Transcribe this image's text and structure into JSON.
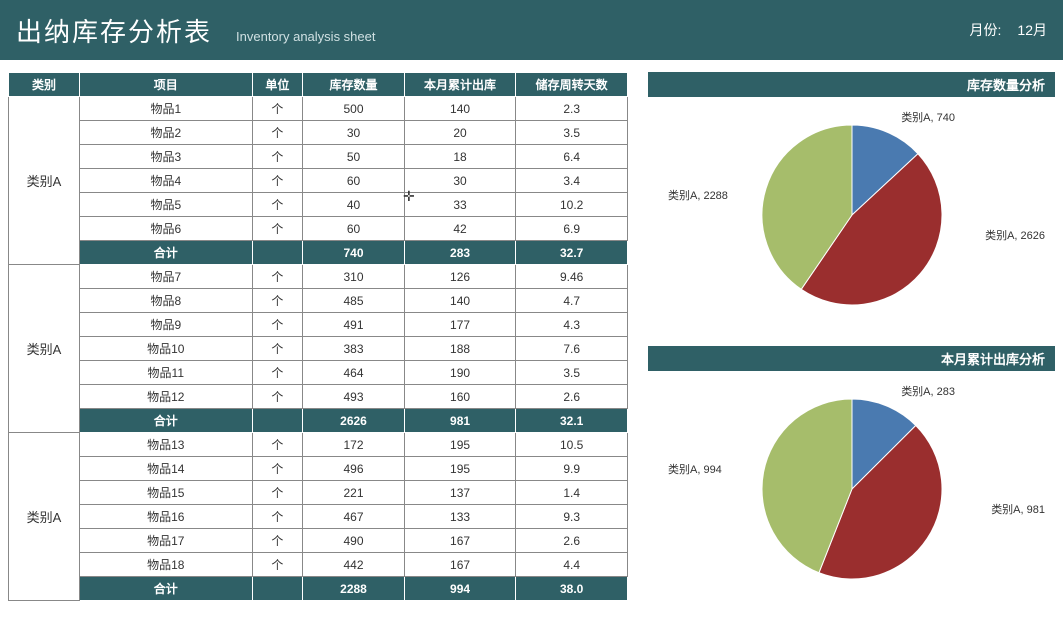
{
  "header": {
    "title": "出纳库存分析表",
    "subtitle": "Inventory analysis sheet",
    "month_label": "月份:",
    "month_value": "12月"
  },
  "columns": {
    "cat": "类别",
    "item": "项目",
    "unit": "单位",
    "qty": "库存数量",
    "out": "本月累计出库",
    "turn": "储存周转天数"
  },
  "subtotal_label": "合计",
  "unit_default": "个",
  "groups": [
    {
      "cat": "类别A",
      "rows": [
        {
          "item": "物品1",
          "unit": "个",
          "qty": 500,
          "out": 140,
          "turn": 2.3
        },
        {
          "item": "物品2",
          "unit": "个",
          "qty": 30,
          "out": 20,
          "turn": 3.5
        },
        {
          "item": "物品3",
          "unit": "个",
          "qty": 50,
          "out": 18,
          "turn": 6.4
        },
        {
          "item": "物品4",
          "unit": "个",
          "qty": 60,
          "out": 30,
          "turn": 3.4
        },
        {
          "item": "物品5",
          "unit": "个",
          "qty": 40,
          "out": 33,
          "turn": 10.2
        },
        {
          "item": "物品6",
          "unit": "个",
          "qty": 60,
          "out": 42,
          "turn": 6.9
        }
      ],
      "subtotal": {
        "qty": 740,
        "out": 283,
        "turn": 32.7
      }
    },
    {
      "cat": "类别A",
      "rows": [
        {
          "item": "物品7",
          "unit": "个",
          "qty": 310,
          "out": 126,
          "turn": 9.46
        },
        {
          "item": "物品8",
          "unit": "个",
          "qty": 485,
          "out": 140,
          "turn": 4.7
        },
        {
          "item": "物品9",
          "unit": "个",
          "qty": 491,
          "out": 177,
          "turn": 4.3
        },
        {
          "item": "物品10",
          "unit": "个",
          "qty": 383,
          "out": 188,
          "turn": 7.6
        },
        {
          "item": "物品11",
          "unit": "个",
          "qty": 464,
          "out": 190,
          "turn": 3.5
        },
        {
          "item": "物品12",
          "unit": "个",
          "qty": 493,
          "out": 160,
          "turn": 2.6
        }
      ],
      "subtotal": {
        "qty": 2626,
        "out": 981,
        "turn": 32.1
      }
    },
    {
      "cat": "类别A",
      "rows": [
        {
          "item": "物品13",
          "unit": "个",
          "qty": 172,
          "out": 195,
          "turn": 10.5
        },
        {
          "item": "物品14",
          "unit": "个",
          "qty": 496,
          "out": 195,
          "turn": 9.9
        },
        {
          "item": "物品15",
          "unit": "个",
          "qty": 221,
          "out": 137,
          "turn": 1.4
        },
        {
          "item": "物品16",
          "unit": "个",
          "qty": 467,
          "out": 133,
          "turn": 9.3
        },
        {
          "item": "物品17",
          "unit": "个",
          "qty": 490,
          "out": 167,
          "turn": 2.6
        },
        {
          "item": "物品18",
          "unit": "个",
          "qty": 442,
          "out": 167,
          "turn": 4.4
        }
      ],
      "subtotal": {
        "qty": 2288,
        "out": 994,
        "turn": "38.0"
      }
    }
  ],
  "chart1": {
    "title": "库存数量分析",
    "labels": [
      "类别A, 740",
      "类别A, 2626",
      "类别A, 2288"
    ]
  },
  "chart2": {
    "title": "本月累计出库分析",
    "labels": [
      "类别A, 283",
      "类别A, 981",
      "类别A, 994"
    ]
  },
  "chart_data": [
    {
      "type": "pie",
      "title": "库存数量分析",
      "series": [
        {
          "name": "类别A",
          "value": 740
        },
        {
          "name": "类别A",
          "value": 2626
        },
        {
          "name": "类别A",
          "value": 2288
        }
      ],
      "colors": [
        "#4a7ab0",
        "#9a2e2e",
        "#a6bd6b"
      ]
    },
    {
      "type": "pie",
      "title": "本月累计出库分析",
      "series": [
        {
          "name": "类别A",
          "value": 283
        },
        {
          "name": "类别A",
          "value": 981
        },
        {
          "name": "类别A",
          "value": 994
        }
      ],
      "colors": [
        "#4a7ab0",
        "#9a2e2e",
        "#a6bd6b"
      ]
    }
  ]
}
